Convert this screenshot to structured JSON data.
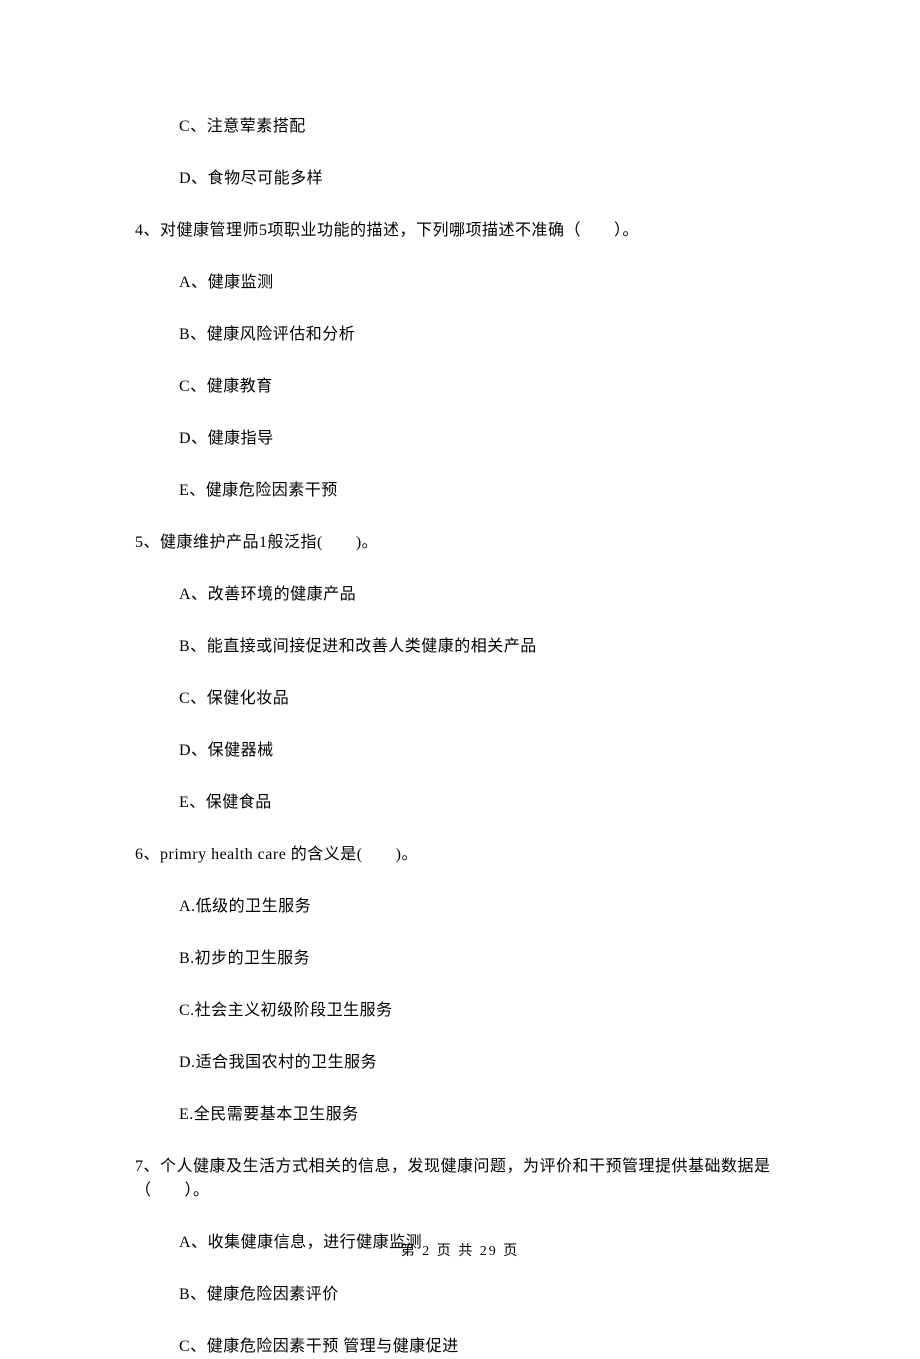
{
  "partial_options_start": [
    {
      "label": "C、",
      "text": "注意荤素搭配"
    },
    {
      "label": "D、",
      "text": "食物尽可能多样"
    }
  ],
  "questions": [
    {
      "number": "4、",
      "stem": "对健康管理师5项职业功能的描述，下列哪项描述不准确（　　）。",
      "options": [
        {
          "label": "A、",
          "text": "健康监测"
        },
        {
          "label": "B、",
          "text": "健康风险评估和分析"
        },
        {
          "label": "C、",
          "text": "健康教育"
        },
        {
          "label": "D、",
          "text": "健康指导"
        },
        {
          "label": "E、",
          "text": "健康危险因素干预"
        }
      ]
    },
    {
      "number": "5、",
      "stem": "健康维护产品1般泛指(　　)。",
      "options": [
        {
          "label": "A、",
          "text": "改善环境的健康产品"
        },
        {
          "label": "B、",
          "text": "能直接或间接促进和改善人类健康的相关产品"
        },
        {
          "label": "C、",
          "text": "保健化妆品"
        },
        {
          "label": "D、",
          "text": "保健器械"
        },
        {
          "label": "E、",
          "text": "保健食品"
        }
      ]
    },
    {
      "number": "6、",
      "stem": "primry health care 的含义是(　　)。",
      "options": [
        {
          "label": "A.",
          "text": "低级的卫生服务"
        },
        {
          "label": "B.",
          "text": "初步的卫生服务"
        },
        {
          "label": "C.",
          "text": "社会主义初级阶段卫生服务"
        },
        {
          "label": "D.",
          "text": "适合我国农村的卫生服务"
        },
        {
          "label": "E.",
          "text": "全民需要基本卫生服务"
        }
      ]
    },
    {
      "number": "7、",
      "stem": "个人健康及生活方式相关的信息，发现健康问题，为评价和干预管理提供基础数据是（　　）。",
      "options": [
        {
          "label": "A、",
          "text": "收集健康信息，进行健康监测"
        },
        {
          "label": "B、",
          "text": "健康危险因素评价"
        },
        {
          "label": "C、",
          "text": "健康危险因素干预 管理与健康促进"
        }
      ]
    }
  ],
  "footer": "第 2 页 共 29 页"
}
